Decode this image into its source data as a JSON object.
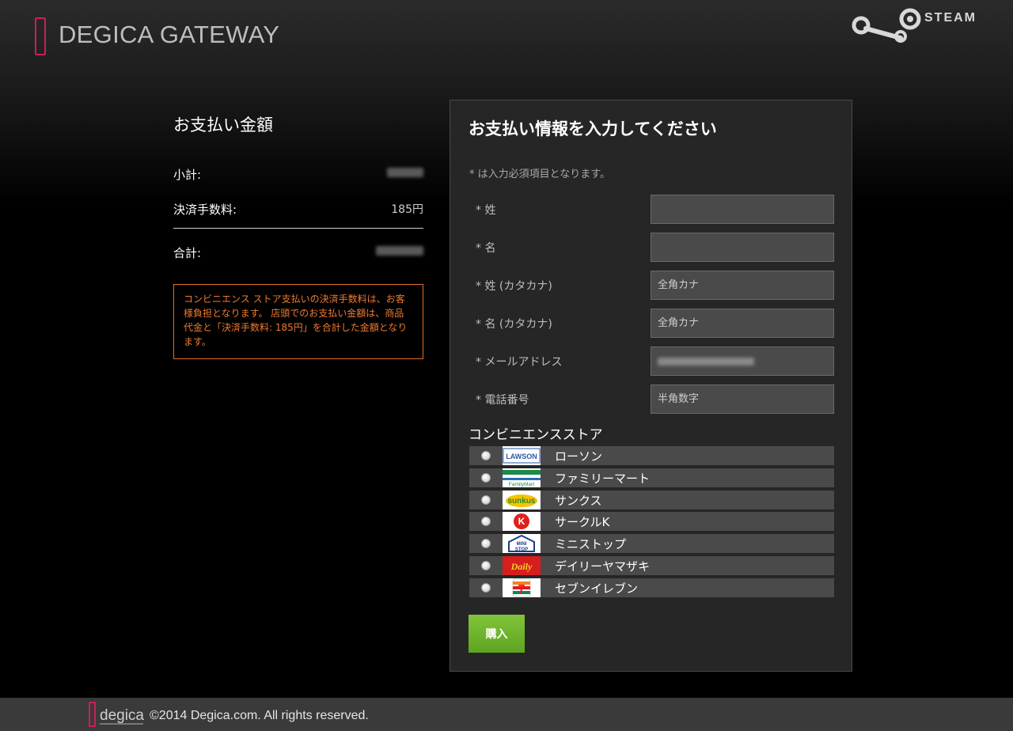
{
  "header": {
    "brand": "DEGICA GATEWAY",
    "steam": "STEAM"
  },
  "summary": {
    "title": "お支払い金額",
    "rows": [
      {
        "label": "小計:",
        "value": "",
        "redacted": true
      },
      {
        "label": "決済手数料:",
        "value": "185円",
        "redacted": false
      },
      {
        "label": "合計:",
        "value": "",
        "redacted": true
      }
    ],
    "notice": "コンビニエンス ストア支払いの決済手数料は、お客様負担となります。 店頭でのお支払い金額は、商品代金と「決済手数料: 185円」を合計した金額となります。"
  },
  "form": {
    "title": "お支払い情報を入力してください",
    "required_note": "* は入力必須項目となります。",
    "fields": [
      {
        "label": "* 姓",
        "placeholder": "",
        "value": ""
      },
      {
        "label": "* 名",
        "placeholder": "",
        "value": ""
      },
      {
        "label": "* 姓 (カタカナ)",
        "placeholder": "全角カナ",
        "value": ""
      },
      {
        "label": "* 名 (カタカナ)",
        "placeholder": "全角カナ",
        "value": ""
      },
      {
        "label": "* メールアドレス",
        "placeholder": "",
        "value": "",
        "redacted": true
      },
      {
        "label": "* 電話番号",
        "placeholder": "半角数字",
        "value": ""
      }
    ],
    "store_title": "コンビニエンスストア",
    "stores": [
      {
        "name": "ローソン",
        "logo": "lawson-logo"
      },
      {
        "name": "ファミリーマート",
        "logo": "familymart-logo"
      },
      {
        "name": "サンクス",
        "logo": "sunkus-logo"
      },
      {
        "name": "サークルK",
        "logo": "circlek-logo"
      },
      {
        "name": "ミニストップ",
        "logo": "ministop-logo"
      },
      {
        "name": "デイリーヤマザキ",
        "logo": "daily-yamazaki-logo"
      },
      {
        "name": "セブンイレブン",
        "logo": "seven-eleven-logo"
      }
    ],
    "buy_label": "購入"
  },
  "footer": {
    "logo": "degica",
    "copyright": "©2014 Degica.com. All rights reserved."
  },
  "colors": {
    "accent": "#c8205a",
    "notice": "#ef7a30",
    "buy": "#6fb22a"
  }
}
